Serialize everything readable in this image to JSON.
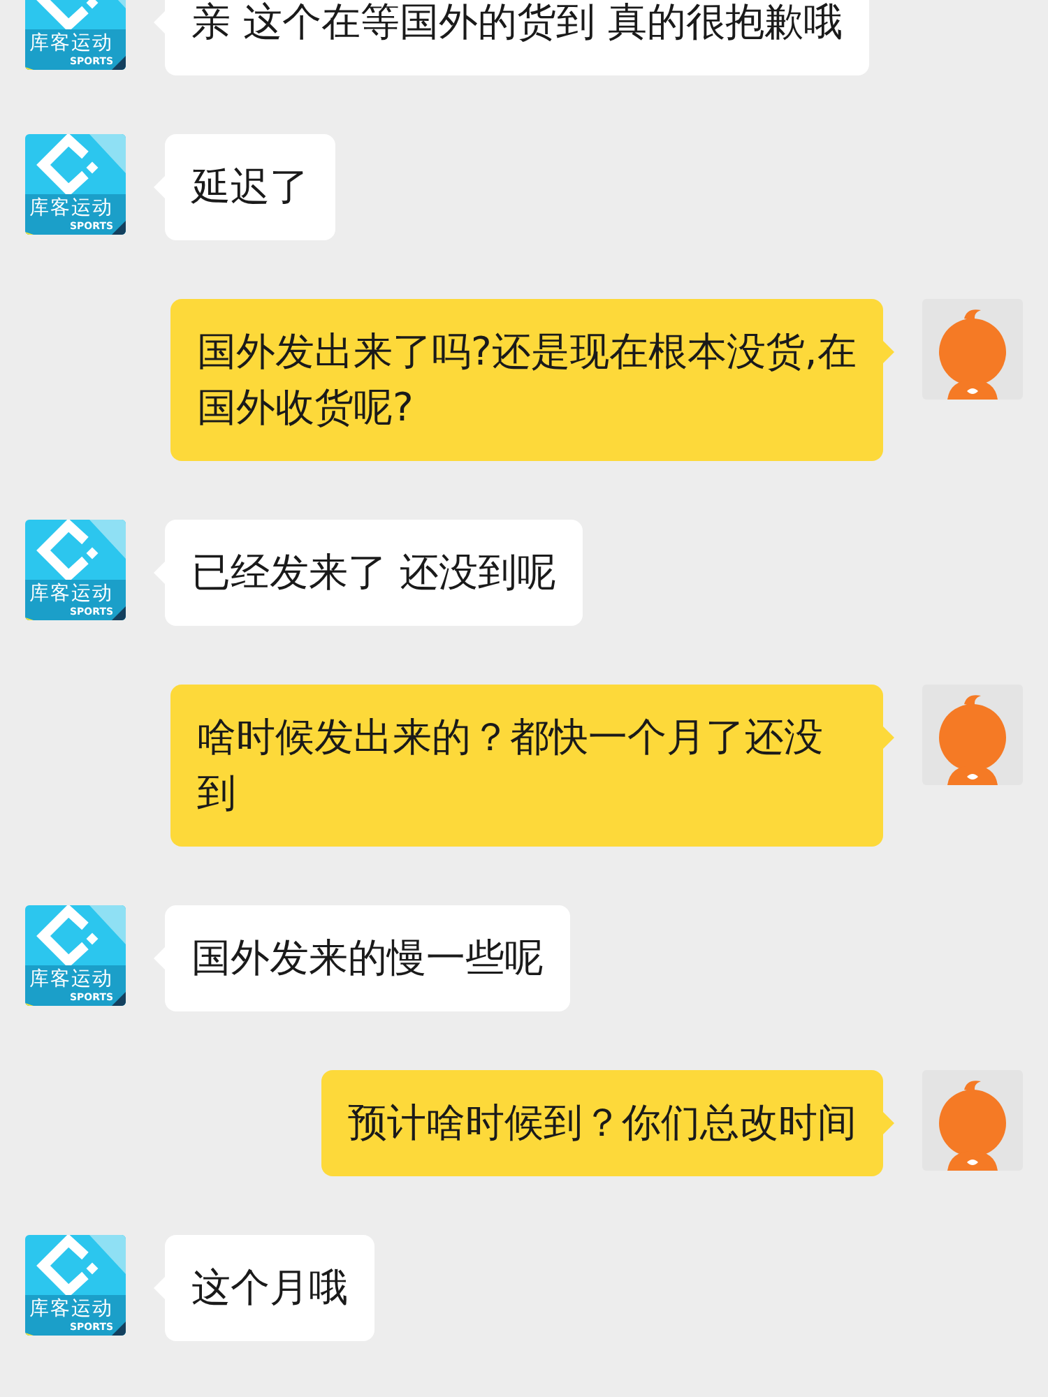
{
  "messages": [
    {
      "kind": "received",
      "text": "亲 这个在等国外的货到 真的很抱歉哦",
      "avatar": {
        "kind": "store",
        "name": "库客运动",
        "subtitle": "SPORTS"
      }
    },
    {
      "kind": "received",
      "text": "延迟了",
      "avatar": {
        "kind": "store",
        "name": "库客运动",
        "subtitle": "SPORTS"
      }
    },
    {
      "kind": "sent",
      "text": "国外发出来了吗?还是现在根本没货,在国外收货呢?",
      "avatar": {
        "kind": "mascot"
      }
    },
    {
      "kind": "received",
      "text": "已经发来了 还没到呢",
      "avatar": {
        "kind": "store",
        "name": "库客运动",
        "subtitle": "SPORTS"
      }
    },
    {
      "kind": "sent",
      "text": "啥时候发出来的？都快一个月了还没到",
      "avatar": {
        "kind": "mascot"
      }
    },
    {
      "kind": "received",
      "text": "国外发来的慢一些呢",
      "avatar": {
        "kind": "store",
        "name": "库客运动",
        "subtitle": "SPORTS"
      }
    },
    {
      "kind": "sent",
      "text": "预计啥时候到？你们总改时间",
      "avatar": {
        "kind": "mascot"
      }
    },
    {
      "kind": "received",
      "text": "这个月哦",
      "avatar": {
        "kind": "store",
        "name": "库客运动",
        "subtitle": "SPORTS"
      }
    }
  ]
}
